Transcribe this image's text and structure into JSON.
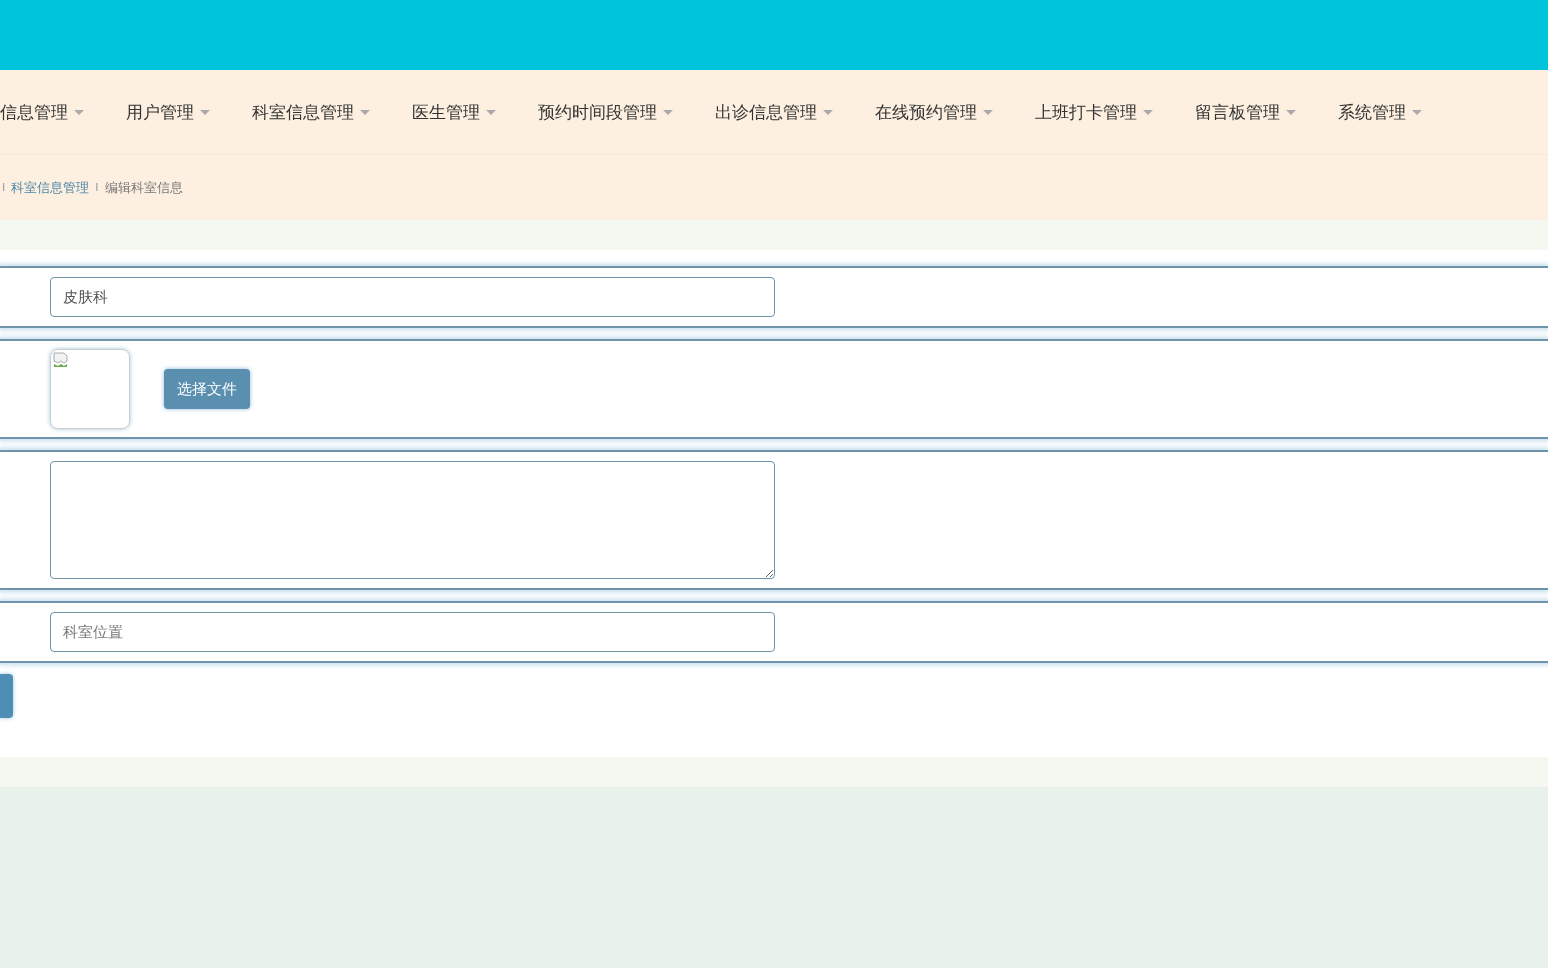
{
  "nav": {
    "items": [
      {
        "label": "信息管理",
        "expanded": false
      },
      {
        "label": "用户管理",
        "expanded": false
      },
      {
        "label": "科室信息管理",
        "expanded": false
      },
      {
        "label": "医生管理",
        "expanded": false
      },
      {
        "label": "预约时间段管理",
        "expanded": false
      },
      {
        "label": "出诊信息管理",
        "expanded": false
      },
      {
        "label": "在线预约管理",
        "expanded": false
      },
      {
        "label": "上班打卡管理",
        "expanded": false
      },
      {
        "label": "留言板管理",
        "expanded": false
      },
      {
        "label": "系统管理",
        "expanded": false
      }
    ]
  },
  "breadcrumb": [
    {
      "separator": "I",
      "label": "科室信息管理",
      "kind": "link"
    },
    {
      "separator": "I",
      "label": "编辑科室信息",
      "kind": "current"
    }
  ],
  "form": {
    "rows": [
      {
        "kind": "input",
        "value": "皮肤科"
      },
      {
        "kind": "image",
        "button": "选择文件"
      },
      {
        "kind": "textarea"
      },
      {
        "kind": "input",
        "placeholder": "科室位置"
      }
    ]
  }
}
